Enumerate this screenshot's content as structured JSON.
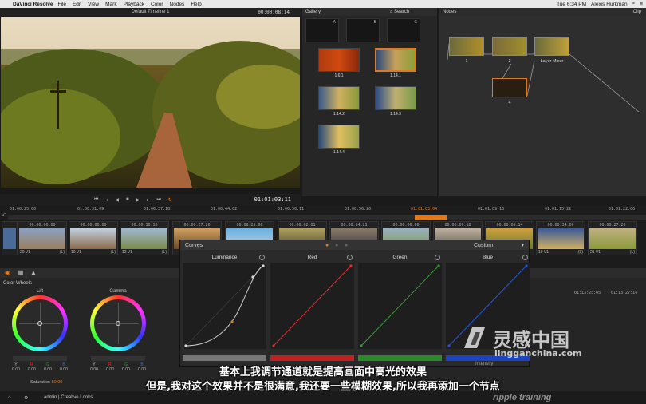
{
  "menubar": {
    "app_name": "DaVinci Resolve",
    "items": [
      "File",
      "Edit",
      "View",
      "Mark",
      "Playback",
      "Color",
      "Nodes",
      "Help"
    ],
    "clock": "Tue 6:34 PM",
    "user": "Alexis Hurkman"
  },
  "viewer": {
    "timeline_name": "Default Timeline 1",
    "timecode": "00:00:08:14",
    "playhead_timecode": "01:01:03:11"
  },
  "gallery": {
    "title": "Gallery",
    "search_label": "Search",
    "album_labels": [
      "A",
      "B",
      "C"
    ],
    "stills": [
      "1.6.1",
      "1.14.1",
      "1.14.2",
      "1.14.3",
      "1.14.4"
    ]
  },
  "nodes": {
    "title": "Nodes",
    "mode": "Clip",
    "node_labels": [
      "1",
      "2",
      "Layer Mixer",
      "4"
    ]
  },
  "timeline": {
    "track_label": "V1",
    "ruler": [
      "01:00:25:00",
      "01:00:31:09",
      "01:00:37:18",
      "01:00:44:02",
      "01:00:50:11",
      "01:00:56:20",
      "01:01:03:04",
      "01:01:09:13",
      "01:01:15:22",
      "01:01:22:06"
    ],
    "clips": [
      {
        "tc": "00:00:00:00",
        "name": "20 V1",
        "flag": "(L)"
      },
      {
        "tc": "00:00:00:00",
        "name": "10 V1",
        "flag": "(L)"
      },
      {
        "tc": "00:00:10:16",
        "name": "12 V1",
        "flag": "(L)"
      },
      {
        "tc": "00:00:27:20",
        "name": "",
        "flag": ""
      },
      {
        "tc": "06:08:25:08",
        "name": "",
        "flag": ""
      },
      {
        "tc": "00:00:02:01",
        "name": "",
        "flag": ""
      },
      {
        "tc": "00:00:14:21",
        "name": "",
        "flag": ""
      },
      {
        "tc": "00:00:06:06",
        "name": "",
        "flag": ""
      },
      {
        "tc": "00:00:09:18",
        "name": "",
        "flag": ""
      },
      {
        "tc": "00:00:05:14",
        "name": "",
        "flag": ""
      },
      {
        "tc": "00:00:34:00",
        "name": "19 V1",
        "flag": "(L)"
      },
      {
        "tc": "00:00:27:20",
        "name": "21 V1",
        "flag": "(L)"
      }
    ]
  },
  "color_wheels": {
    "title": "Color Wheels",
    "wheels": [
      "Lift",
      "Gamma"
    ],
    "channel_labels": [
      "Y",
      "R",
      "G",
      "B"
    ],
    "lift_values": [
      "0.00",
      "0.00",
      "0.00",
      "0.00"
    ],
    "gamma_values": [
      "0.00",
      "0.00",
      "0.00",
      "0.00"
    ],
    "saturation_label": "Saturation",
    "saturation_value": "50.00"
  },
  "curves": {
    "title": "Curves",
    "mode": "Custom",
    "channels": [
      "Luminance",
      "Red",
      "Green",
      "Blue"
    ],
    "intensity_label": "Intensity",
    "intensity_value": "100"
  },
  "right_info": {
    "tc1": "01:13:25:05",
    "tc2": "01:13:27:14"
  },
  "bottom": {
    "user": "admin | Creative Looks"
  },
  "subtitles": {
    "line1": "基本上我调节通道就是提高画面中高光的效果",
    "line2": "但是,我对这个效果并不是很满意,我还要一些模糊效果,所以我再添加一个节点"
  },
  "watermark": {
    "big": "灵感中国",
    "small": "lingganchina.com",
    "corner": "ripple training"
  },
  "colors": {
    "accent": "#e07a1f",
    "red_curve": "#e03030",
    "green_curve": "#3a9a3a",
    "blue_curve": "#2255dd"
  }
}
